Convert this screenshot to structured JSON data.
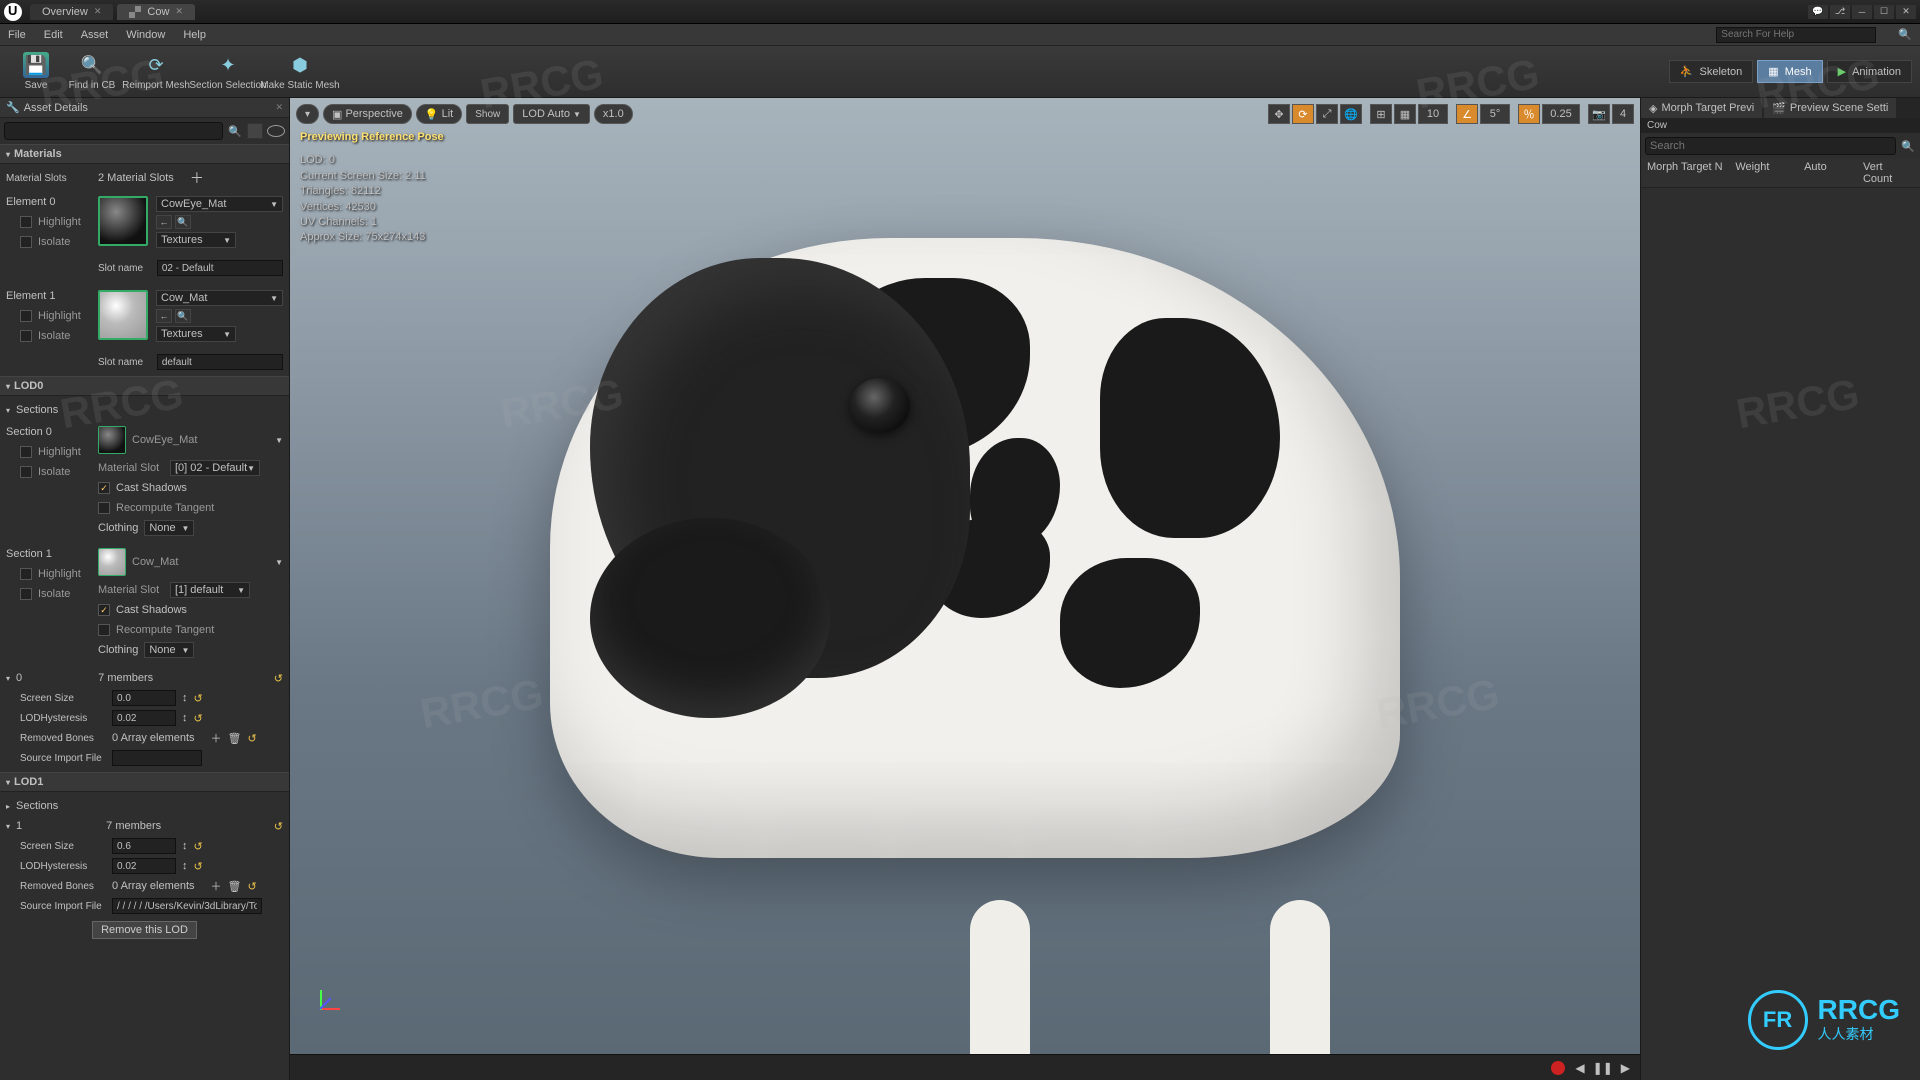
{
  "title": {
    "tab1": "Overview",
    "tab2": "Cow"
  },
  "menu": {
    "file": "File",
    "edit": "Edit",
    "asset": "Asset",
    "window": "Window",
    "help": "Help",
    "search_placeholder": "Search For Help"
  },
  "toolbar": {
    "save": "Save",
    "find": "Find in CB",
    "reimport": "Reimport Mesh",
    "section": "Section Selection",
    "static": "Make Static Mesh"
  },
  "modes": {
    "skeleton": "Skeleton",
    "mesh": "Mesh",
    "animation": "Animation"
  },
  "left": {
    "tab": "Asset Details",
    "materials": {
      "title": "Materials",
      "slots_label": "Material Slots",
      "slots_value": "2 Material Slots"
    },
    "element0": {
      "label": "Element 0",
      "highlight": "Highlight",
      "isolate": "Isolate",
      "mat": "CowEye_Mat",
      "textures": "Textures",
      "slot_label": "Slot name",
      "slot_value": "02 - Default"
    },
    "element1": {
      "label": "Element 1",
      "highlight": "Highlight",
      "isolate": "Isolate",
      "mat": "Cow_Mat",
      "textures": "Textures",
      "slot_label": "Slot name",
      "slot_value": "default"
    },
    "lod0": {
      "title": "LOD0",
      "sections": "Sections",
      "s0": {
        "label": "Section 0",
        "highlight": "Highlight",
        "isolate": "Isolate",
        "mat": "CowEye_Mat",
        "material_slot_label": "Material Slot",
        "material_slot": "[0] 02 - Default",
        "cast": "Cast Shadows",
        "recompute": "Recompute Tangent",
        "clothing_label": "Clothing",
        "clothing": "None"
      },
      "s1": {
        "label": "Section 1",
        "highlight": "Highlight",
        "isolate": "Isolate",
        "mat": "Cow_Mat",
        "material_slot_label": "Material Slot",
        "material_slot": "[1] default",
        "cast": "Cast Shadows",
        "recompute": "Recompute Tangent",
        "clothing_label": "Clothing",
        "clothing": "None"
      },
      "zero": {
        "label": "0",
        "members": "7 members",
        "screen_label": "Screen Size",
        "screen": "0.0",
        "hyst_label": "LODHysteresis",
        "hyst": "0.02",
        "bones_label": "Removed Bones",
        "bones": "0 Array elements",
        "src_label": "Source Import File"
      }
    },
    "lod1": {
      "title": "LOD1",
      "sections": "Sections",
      "one_label": "1",
      "members": "7 members",
      "screen_label": "Screen Size",
      "screen": "0.6",
      "hyst_label": "LODHysteresis",
      "hyst": "0.02",
      "bones_label": "Removed Bones",
      "bones": "0 Array elements",
      "src_label": "Source Import File",
      "src": "/ / / / / /Users/Kevin/3dLibrary/To",
      "remove": "Remove this LOD"
    }
  },
  "viewport": {
    "buttons": {
      "perspective": "Perspective",
      "lit": "Lit",
      "show": "Show",
      "lod": "LOD Auto",
      "speed": "x1.0"
    },
    "right": {
      "grid_snap": "10",
      "angle_snap": "5°",
      "scale_snap": "0.25",
      "cam": "4"
    },
    "overlay": {
      "preview": "Previewing Reference Pose",
      "lod": "LOD: 0",
      "screen": "Current Screen Size: 2.11",
      "tris": "Triangles: 82112",
      "verts": "Vertices: 42530",
      "uv": "UV Channels: 1",
      "approx": "Approx Size: 75x274x143"
    }
  },
  "right": {
    "tab1": "Morph Target Previ",
    "tab2": "Preview Scene Setti",
    "asset": "Cow",
    "search_placeholder": "Search",
    "col1": "Morph Target N",
    "col2": "Weight",
    "col3": "Auto",
    "col4": "Vert Count"
  },
  "brand": {
    "name": "RRCG",
    "sub": "人人素材"
  }
}
